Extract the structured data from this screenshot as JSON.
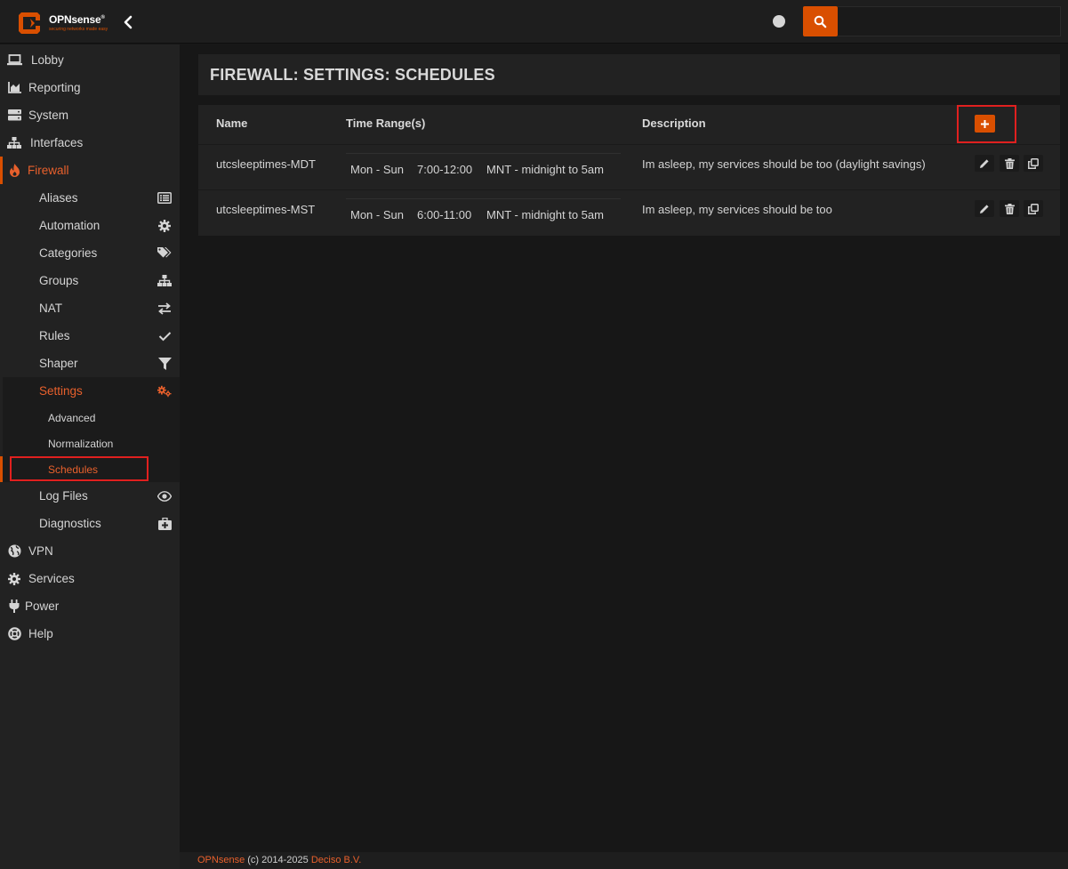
{
  "app": {
    "brand": "OPNsense",
    "brand_mark": "®",
    "tagline": "securing networks made easy",
    "colors": {
      "accent": "#d94f00",
      "active_text": "#e8602c",
      "highlight": "#e0201f"
    }
  },
  "topbar": {
    "search_placeholder": "",
    "icons": [
      "chevron-left-icon",
      "status-dot-icon",
      "search-icon"
    ]
  },
  "sidebar": {
    "items": [
      {
        "label": "Lobby",
        "icon": "laptop-icon"
      },
      {
        "label": "Reporting",
        "icon": "area-chart-icon"
      },
      {
        "label": "System",
        "icon": "server-icon"
      },
      {
        "label": "Interfaces",
        "icon": "sitemap-icon"
      },
      {
        "label": "Firewall",
        "icon": "fire-icon",
        "active": true
      },
      {
        "label": "VPN",
        "icon": "globe-icon"
      },
      {
        "label": "Services",
        "icon": "cog-icon"
      },
      {
        "label": "Power",
        "icon": "plug-icon"
      },
      {
        "label": "Help",
        "icon": "lifebuoy-icon"
      }
    ],
    "firewall_sub": [
      {
        "label": "Aliases",
        "icon": "list-icon"
      },
      {
        "label": "Automation",
        "icon": "cog-icon"
      },
      {
        "label": "Categories",
        "icon": "tags-icon"
      },
      {
        "label": "Groups",
        "icon": "sitemap-icon"
      },
      {
        "label": "NAT",
        "icon": "exchange-icon"
      },
      {
        "label": "Rules",
        "icon": "check-icon"
      },
      {
        "label": "Shaper",
        "icon": "filter-icon"
      },
      {
        "label": "Settings",
        "icon": "cogs-icon",
        "active": true
      },
      {
        "label": "Log Files",
        "icon": "eye-icon"
      },
      {
        "label": "Diagnostics",
        "icon": "medkit-icon"
      }
    ],
    "settings_sub": [
      {
        "label": "Advanced"
      },
      {
        "label": "Normalization"
      },
      {
        "label": "Schedules",
        "active": true
      }
    ]
  },
  "main": {
    "title": "FIREWALL: SETTINGS: SCHEDULES",
    "columns": [
      "Name",
      "Time Range(s)",
      "Description"
    ],
    "rows": [
      {
        "name": "utcsleeptimes-MDT",
        "days": "Mon - Sun",
        "time": "7:00-12:00",
        "range_desc": "MNT - midnight to 5am",
        "description": "Im asleep, my services should be too (daylight savings)"
      },
      {
        "name": "utcsleeptimes-MST",
        "days": "Mon - Sun",
        "time": "6:00-11:00",
        "range_desc": "MNT - midnight to 5am",
        "description": "Im asleep, my services should be too"
      }
    ],
    "add_label": "+"
  },
  "footer": {
    "brand": "OPNsense",
    "copyright": "(c) 2014-2025",
    "company": "Deciso B.V."
  }
}
